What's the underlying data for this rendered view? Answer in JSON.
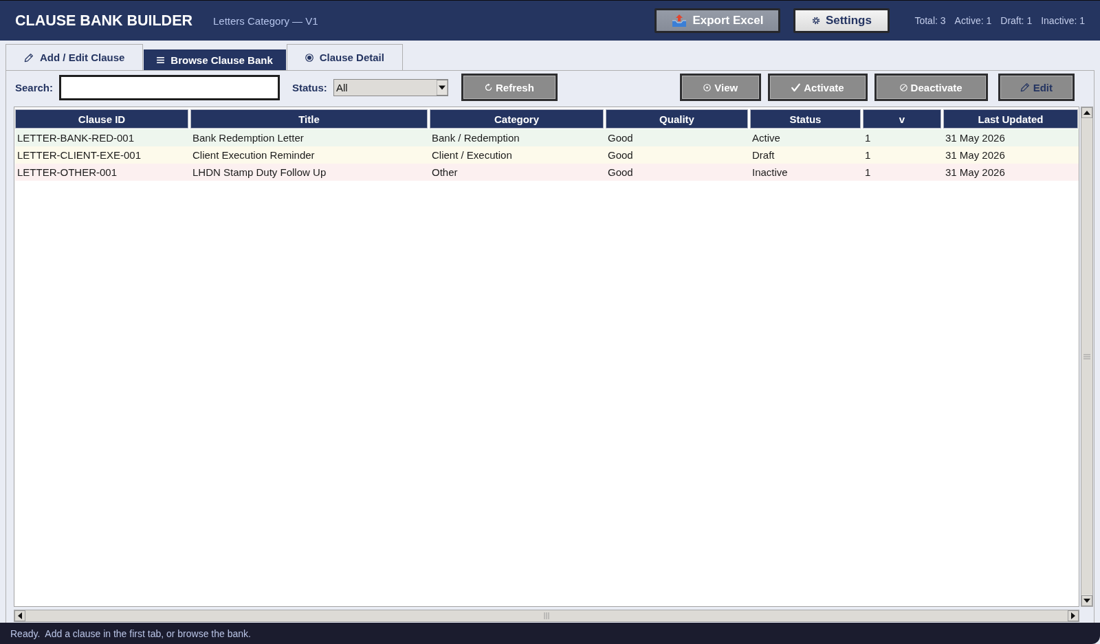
{
  "header": {
    "title": "CLAUSE BANK BUILDER",
    "subtitle": "Letters Category — V1",
    "buttons": [
      {
        "label": "Export Excel",
        "kind": "export"
      },
      {
        "label": "Settings",
        "kind": "settings"
      }
    ],
    "stats": [
      "Total: 3",
      "Active: 1",
      "Draft: 1",
      "Inactive: 1"
    ]
  },
  "tabs": [
    {
      "label": "Add / Edit Clause",
      "kind": "edit",
      "selected": false
    },
    {
      "label": "Browse Clause Bank",
      "kind": "list",
      "selected": true
    },
    {
      "label": "Clause Detail",
      "kind": "detail",
      "selected": false
    }
  ],
  "filters": {
    "search": {
      "label": "Search:"
    },
    "status": {
      "label": "Status:",
      "value": "All"
    }
  },
  "toolbar": {
    "refresh": {
      "label": "Refresh"
    },
    "actions": [
      {
        "label": "View",
        "kind": "view"
      },
      {
        "label": "Activate",
        "kind": "activate"
      },
      {
        "label": "Deactivate",
        "kind": "deactivate"
      },
      {
        "label": "Edit",
        "kind": "edit"
      }
    ]
  },
  "table": {
    "columns": [
      "Clause ID",
      "Title",
      "Category",
      "Quality",
      "Status",
      "v",
      "Last Updated"
    ],
    "rows": [
      {
        "color": "#eef6ee",
        "cells": [
          "LETTER-BANK-RED-001",
          "Bank Redemption Letter",
          "Bank / Redemption",
          "Good",
          "Active",
          "1",
          "31 May 2026"
        ]
      },
      {
        "color": "#fdfaeb",
        "cells": [
          "LETTER-CLIENT-EXE-001",
          "Client Execution Reminder",
          "Client / Execution",
          "Good",
          "Draft",
          "1",
          "31 May 2026"
        ]
      },
      {
        "color": "#fcf0f0",
        "cells": [
          "LETTER-OTHER-001",
          "LHDN Stamp Duty Follow Up",
          "Other",
          "Good",
          "Inactive",
          "1",
          "31 May 2026"
        ]
      }
    ]
  },
  "status_bar": {
    "text": "Ready.  Add a clause in the first tab, or browse the bank."
  }
}
